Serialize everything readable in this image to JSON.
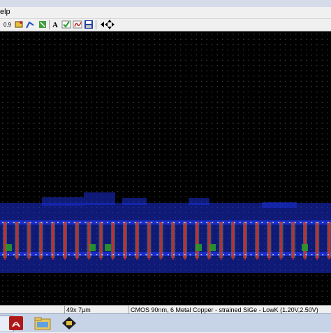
{
  "menubar": {
    "help_label": "elp"
  },
  "toolbar": {
    "icons": [
      "grid-icon",
      "properties-icon",
      "route-icon",
      "cursor-icon",
      "text-icon",
      "check-icon",
      "compile-icon",
      "save-icon",
      "arrow-left-icon",
      "pan-icon"
    ],
    "text_tool_label": "A"
  },
  "statusbar": {
    "zoom_size": "49x 7µm",
    "technology": "CMOS 90nm, 6 Metal Copper - strained SiGe - LowK (1.20V,2.50V)"
  },
  "taskbar": {
    "items": [
      "taskbar-app-icon",
      "pdf-reader-icon",
      "folder-icon",
      "layout-editor-icon"
    ]
  },
  "colors": {
    "canvas_bg": "#000000",
    "metal1": "#1a2fd6",
    "poly": "#d42a2a",
    "diffusion": "#2a9a2a",
    "contact": "#c0c0c0",
    "nwell": "#c08a3a"
  }
}
